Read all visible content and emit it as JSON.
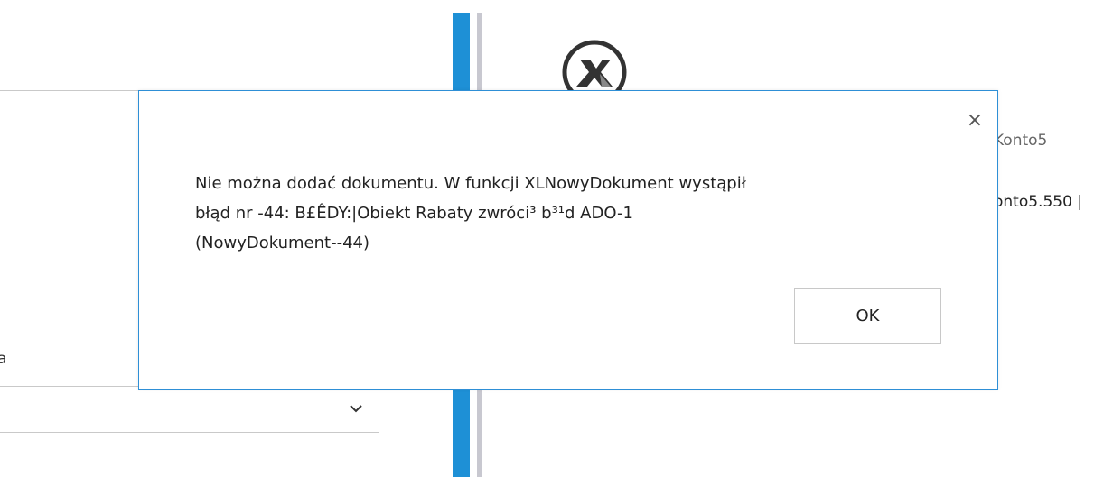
{
  "background": {
    "field_label": "a",
    "konto_title": "Konto5",
    "konto_value": "onto5.550 |",
    "logo_icon": "comarch-xl-logo-icon",
    "select_icon": "chevron-down-icon",
    "accent_color": "#1e90d6"
  },
  "dialog": {
    "message_lines": [
      "Nie można dodać dokumentu. W funkcji XLNowyDokument wystąpił",
      "błąd nr -44: B£ÊDY:|Obiekt Rabaty zwróci³ b³¹d ADO-1",
      "(NowyDokument--44)"
    ],
    "close_label": "×",
    "ok_label": "OK",
    "border_color": "#2e8fd6"
  }
}
